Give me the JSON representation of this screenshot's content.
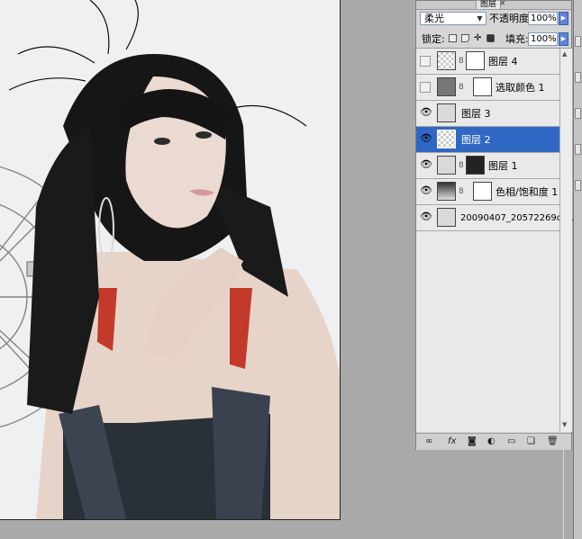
{
  "canvas": {
    "description_icon": "photo-canvas"
  },
  "layers_panel": {
    "tab_label": "图层",
    "tab_close": "×",
    "blend_mode": "柔光",
    "opacity_label": "不透明度:",
    "opacity_value": "100%",
    "lock_label": "锁定:",
    "fill_label": "填充:",
    "fill_value": "100%",
    "layers": [
      {
        "name": "图层 4",
        "visible": false,
        "selected": false
      },
      {
        "name": "选取颜色 1",
        "visible": false,
        "selected": false
      },
      {
        "name": "图层 3",
        "visible": true,
        "selected": false
      },
      {
        "name": "图层 2",
        "visible": true,
        "selected": true
      },
      {
        "name": "图层 1",
        "visible": true,
        "selected": false
      },
      {
        "name": "色相/饱和度 1",
        "visible": true,
        "selected": false
      },
      {
        "name": "20090407_20572269d5...",
        "visible": true,
        "selected": false
      }
    ],
    "bottom_icons": [
      "link-icon",
      "fx-icon",
      "mask-icon",
      "adjustment-icon",
      "folder-icon",
      "new-layer-icon",
      "trash-icon"
    ],
    "fx_label": "fx"
  },
  "colors": {
    "selection": "#3167c4",
    "stepper": "#5e84d6",
    "workspace": "#a9a9a9"
  }
}
